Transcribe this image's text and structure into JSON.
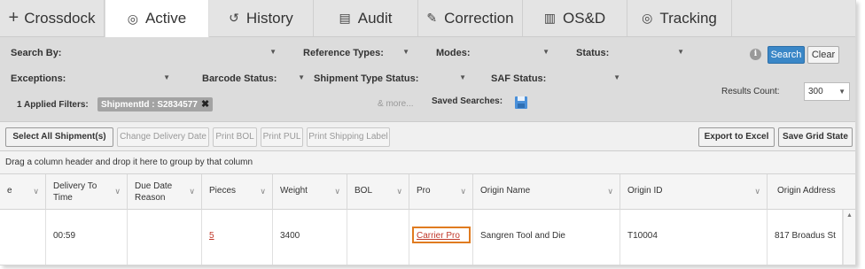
{
  "tabs": [
    {
      "icon": "plus-icon",
      "glyph": "+",
      "label": "Crossdock"
    },
    {
      "icon": "circle-icon",
      "glyph": "◎",
      "label": "Active"
    },
    {
      "icon": "history-icon",
      "glyph": "↺",
      "label": "History"
    },
    {
      "icon": "audit-icon",
      "glyph": "▤",
      "label": "Audit"
    },
    {
      "icon": "pencil-icon",
      "glyph": "✎",
      "label": "Correction"
    },
    {
      "icon": "barcode-icon",
      "glyph": "▥",
      "label": "OS&D"
    },
    {
      "icon": "circle-icon",
      "glyph": "◎",
      "label": "Tracking"
    }
  ],
  "filters": {
    "search_by": "Search By:",
    "reference_types": "Reference Types:",
    "modes": "Modes:",
    "status": "Status:",
    "exceptions": "Exceptions:",
    "barcode_status": "Barcode Status:",
    "shipment_type_status": "Shipment Type Status:",
    "saf_status": "SAF Status:",
    "search_button": "Search",
    "clear_button": "Clear",
    "results_count_label": "Results Count:",
    "results_count_value": "300",
    "applied_filters_label": "1 Applied Filters:",
    "applied_chip": "ShipmentId : S2834577",
    "more_text": "& more...",
    "saved_searches_label": "Saved Searches:"
  },
  "toolbar": {
    "select_all": "Select All Shipment(s)",
    "change_delivery_date": "Change Delivery Date",
    "print_bol": "Print BOL",
    "print_pul": "Print PUL",
    "print_shipping_label": "Print Shipping Label",
    "export_excel": "Export to Excel",
    "save_grid_state": "Save Grid State"
  },
  "group_bar_text": "Drag a column header and drop it here to group by that column",
  "grid": {
    "columns": [
      "e",
      "Delivery To Time",
      "Due Date Reason",
      "Pieces",
      "Weight",
      "BOL",
      "Pro",
      "Origin Name",
      "Origin ID",
      "Origin Address"
    ],
    "col1_line1": "Delivery To",
    "col1_line2": "Time",
    "col2_line1": "Due Date",
    "col2_line2": "Reason",
    "row": {
      "delivery_to_time": "00:59",
      "due_date_reason": "",
      "pieces": "5",
      "weight": "3400",
      "bol": "",
      "pro": "Carrier Pro",
      "origin_name": "Sangren Tool and Die",
      "origin_id": "T10004",
      "origin_address": "817 Broadus St"
    }
  }
}
